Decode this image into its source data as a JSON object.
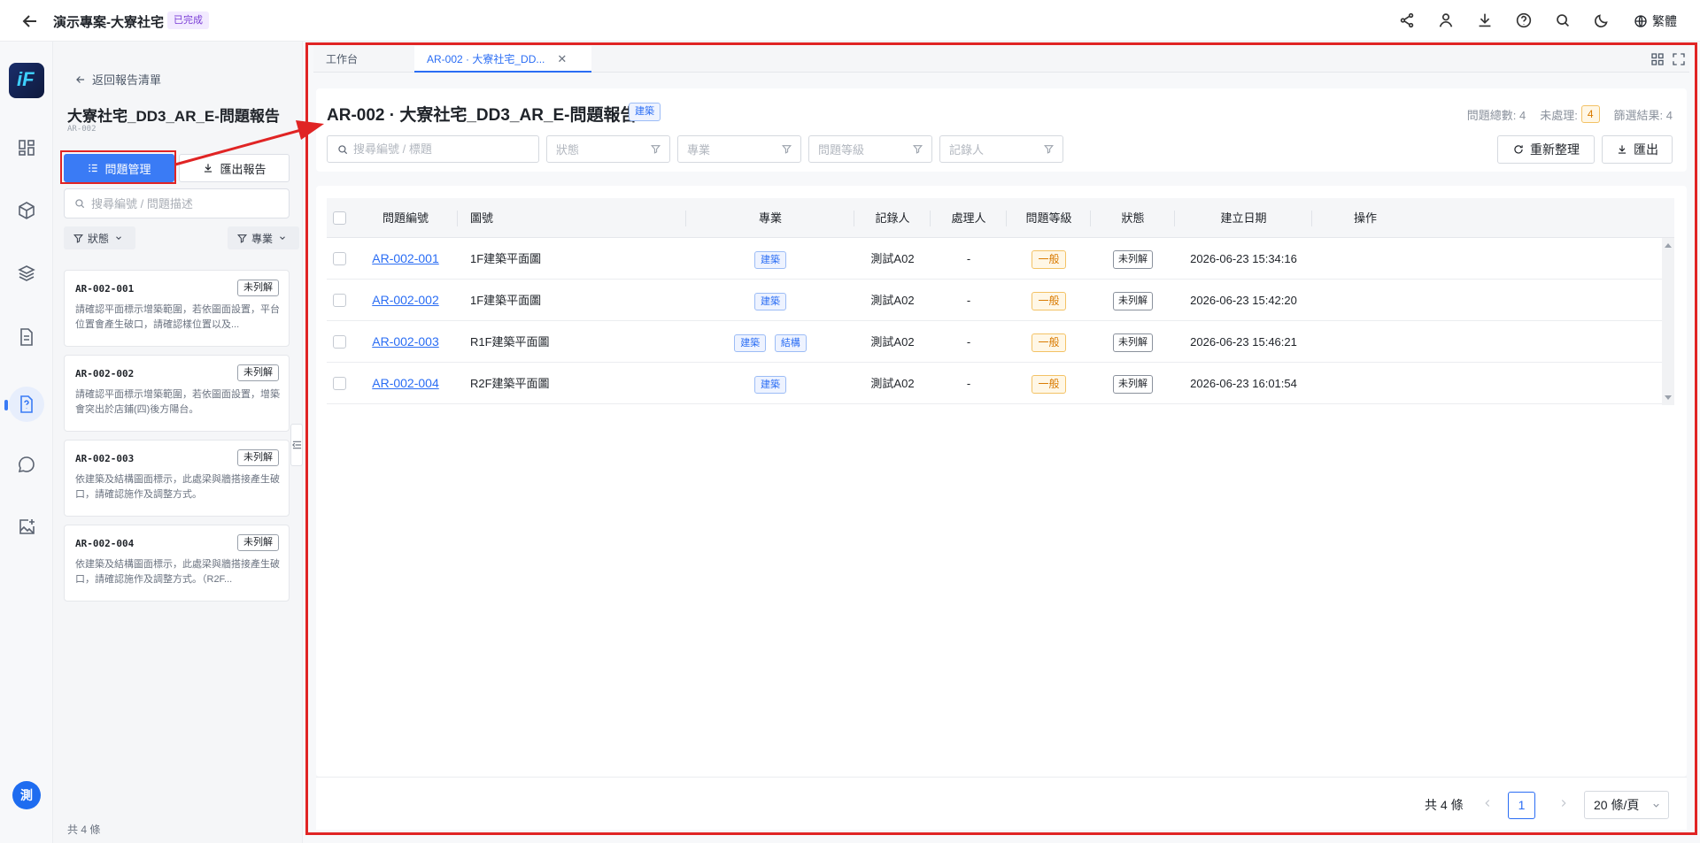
{
  "header": {
    "project_title": "演示專案-大寮社宅",
    "status_badge": "已完成",
    "language": "繁體",
    "icons": [
      "share-icon",
      "user-switch-icon",
      "download-icon",
      "help-icon",
      "search-icon",
      "dark-mode-icon",
      "globe-icon"
    ]
  },
  "rail": {
    "logo_text": "iF",
    "avatar_text": "測",
    "items": [
      "dashboard-icon",
      "cube-icon",
      "layers-icon",
      "document-icon",
      "issue-report-icon",
      "chat-icon",
      "image-add-icon"
    ]
  },
  "sidebar": {
    "back_label": "返回報告清單",
    "report_title": "大寮社宅_DD3_AR_E-問題報告",
    "report_code": "AR-002",
    "issue_button": "問題管理",
    "export_button": "匯出報告",
    "search_placeholder": "搜尋編號 / 問題描述",
    "filter_status": "狀態",
    "filter_discipline": "專業",
    "cards": [
      {
        "id": "AR-002-001",
        "status": "未列解",
        "desc": "請確認平面標示增築範圍，若依圖面設置，平台位置會產生破口，請確認樣位置以及..."
      },
      {
        "id": "AR-002-002",
        "status": "未列解",
        "desc": "請確認平面標示增築範圍，若依圖面設置，增築會突出於店鋪(四)後方陽台。"
      },
      {
        "id": "AR-002-003",
        "status": "未列解",
        "desc": "依建築及結構圖面標示，此處梁與牆搭接產生破口，請確認施作及調整方式。"
      },
      {
        "id": "AR-002-004",
        "status": "未列解",
        "desc": "依建築及結構圖面標示，此處梁與牆搭接產生破口，請確認施作及調整方式。（R2F..."
      }
    ],
    "footer_count": "共 4 條"
  },
  "tabs": [
    {
      "label": "工作台",
      "active": false
    },
    {
      "label": "AR-002 · 大寮社宅_DD...",
      "active": true
    }
  ],
  "panel": {
    "title": "AR-002 · 大寮社宅_DD3_AR_E-問題報告",
    "tag": "建築",
    "stats": {
      "total_label": "問題總數: 4",
      "pending_label": "未處理:",
      "pending_value": "4",
      "filtered_label": "篩選結果: 4"
    },
    "search_placeholder": "搜尋編號 / 標題",
    "filters": [
      "狀態",
      "專業",
      "問題等級",
      "記錄人"
    ],
    "refresh_button": "重新整理",
    "export_button": "匯出"
  },
  "table": {
    "columns": [
      "問題編號",
      "圖號",
      "專業",
      "記錄人",
      "處理人",
      "問題等級",
      "狀態",
      "建立日期",
      "操作"
    ],
    "rows": [
      {
        "id": "AR-002-001",
        "drawing": "1F建築平面圖",
        "disciplines": [
          "建築"
        ],
        "recorder": "測試A02",
        "handler": "-",
        "level": "一般",
        "status": "未列解",
        "created": "2026-06-23 15:34:16"
      },
      {
        "id": "AR-002-002",
        "drawing": "1F建築平面圖",
        "disciplines": [
          "建築"
        ],
        "recorder": "測試A02",
        "handler": "-",
        "level": "一般",
        "status": "未列解",
        "created": "2026-06-23 15:42:20"
      },
      {
        "id": "AR-002-003",
        "drawing": "R1F建築平面圖",
        "disciplines": [
          "建築",
          "結構"
        ],
        "recorder": "測試A02",
        "handler": "-",
        "level": "一般",
        "status": "未列解",
        "created": "2026-06-23 15:46:21"
      },
      {
        "id": "AR-002-004",
        "drawing": "R2F建築平面圖",
        "disciplines": [
          "建築"
        ],
        "recorder": "測試A02",
        "handler": "-",
        "level": "一般",
        "status": "未列解",
        "created": "2026-06-23 16:01:54"
      }
    ]
  },
  "pagination": {
    "total": "共 4 條",
    "current_page": "1",
    "page_size": "20 條/頁"
  },
  "annotation_color": "#e02424",
  "accent_color": "#3a7bf5"
}
